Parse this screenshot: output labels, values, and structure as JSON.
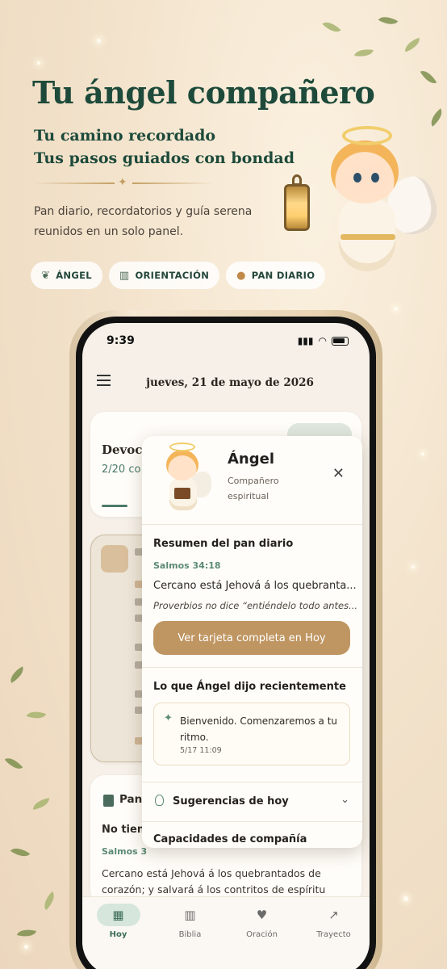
{
  "hero": {
    "title": "Tu ángel compañero",
    "subtitle_line1": "Tu camino recordado",
    "subtitle_line2": "Tus pasos guiados con bondad",
    "description": "Pan diario, recordatorios y guía serena reunidos en un solo panel."
  },
  "chips": [
    {
      "label": "ÁNGEL",
      "icon": "angel-icon"
    },
    {
      "label": "ORIENTACIÓN",
      "icon": "book-icon"
    },
    {
      "label": "PAN DIARIO",
      "icon": "bread-icon"
    }
  ],
  "phone": {
    "time": "9:39",
    "date": "jueves, 21 de mayo de 2026",
    "devotional": {
      "title": "Devoci",
      "count": "2/20 co"
    },
    "pan_card": {
      "title": "Pan",
      "no_text": "No tiene",
      "ref": "Salmos 3",
      "text": "Cercano está Jehová á los quebrantados de corazón; y salvará á los contritos de espíritu"
    },
    "panel": {
      "name": "Ángel",
      "role": "Compañero espiritual",
      "close": "✕",
      "summary_title": "Resumen del pan diario",
      "ref": "Salmos 34:18",
      "verse": "Cercano está Jehová á los quebranta...",
      "quote": "Proverbios no dice “entiéndelo todo antes...",
      "button": "Ver tarjeta completa en Hoy",
      "recent_title": "Lo que Ángel dijo recientemente",
      "message": "Bienvenido. Comenzaremos a tu ritmo.",
      "message_time": "5/17 11:09",
      "suggestions": "Sugerencias de hoy",
      "capabilities": "Capacidades de compañía"
    },
    "tabs": [
      {
        "label": "Hoy",
        "icon": "calendar-icon",
        "active": true
      },
      {
        "label": "Biblia",
        "icon": "bible-icon",
        "active": false
      },
      {
        "label": "Oración",
        "icon": "heart-icon",
        "active": false
      },
      {
        "label": "Trayecto",
        "icon": "trend-icon",
        "active": false
      }
    ]
  },
  "colors": {
    "brand_green": "#1d4a3a",
    "accent_gold": "#bf9662",
    "active_tab": "#d6e6dc"
  }
}
